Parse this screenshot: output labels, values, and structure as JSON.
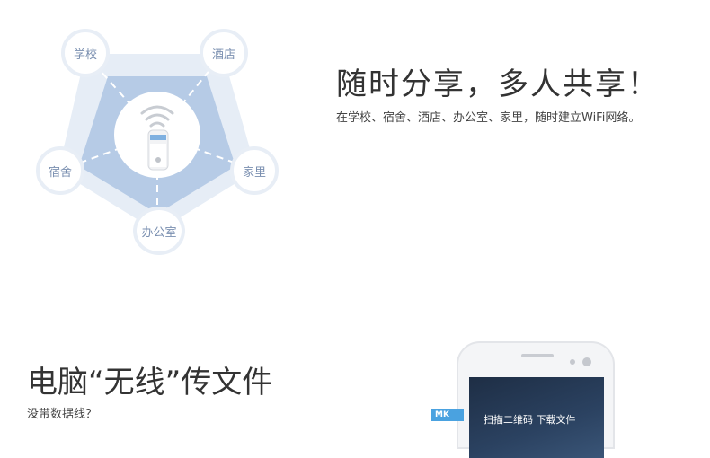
{
  "diagram": {
    "nodes": {
      "school": "学校",
      "hotel": "酒店",
      "dorm": "宿舍",
      "home": "家里",
      "office": "办公室"
    }
  },
  "section1": {
    "headline": "随时分享，多人共享！",
    "subtitle": "在学校、宿舍、酒店、办公室、家里，随时建立WiFi网络。"
  },
  "section2": {
    "headline": "电脑“无线”传文件",
    "subtitle": "没带数据线？",
    "phone_screen_label": "扫描二维码 下载文件",
    "tag_label": "MK"
  },
  "colors": {
    "outer_pentagon": "#e6edf6",
    "inner_pentagon": "#b6cbe6",
    "node_text": "#7a8fb0",
    "tag_blue": "#4aa2e0"
  }
}
